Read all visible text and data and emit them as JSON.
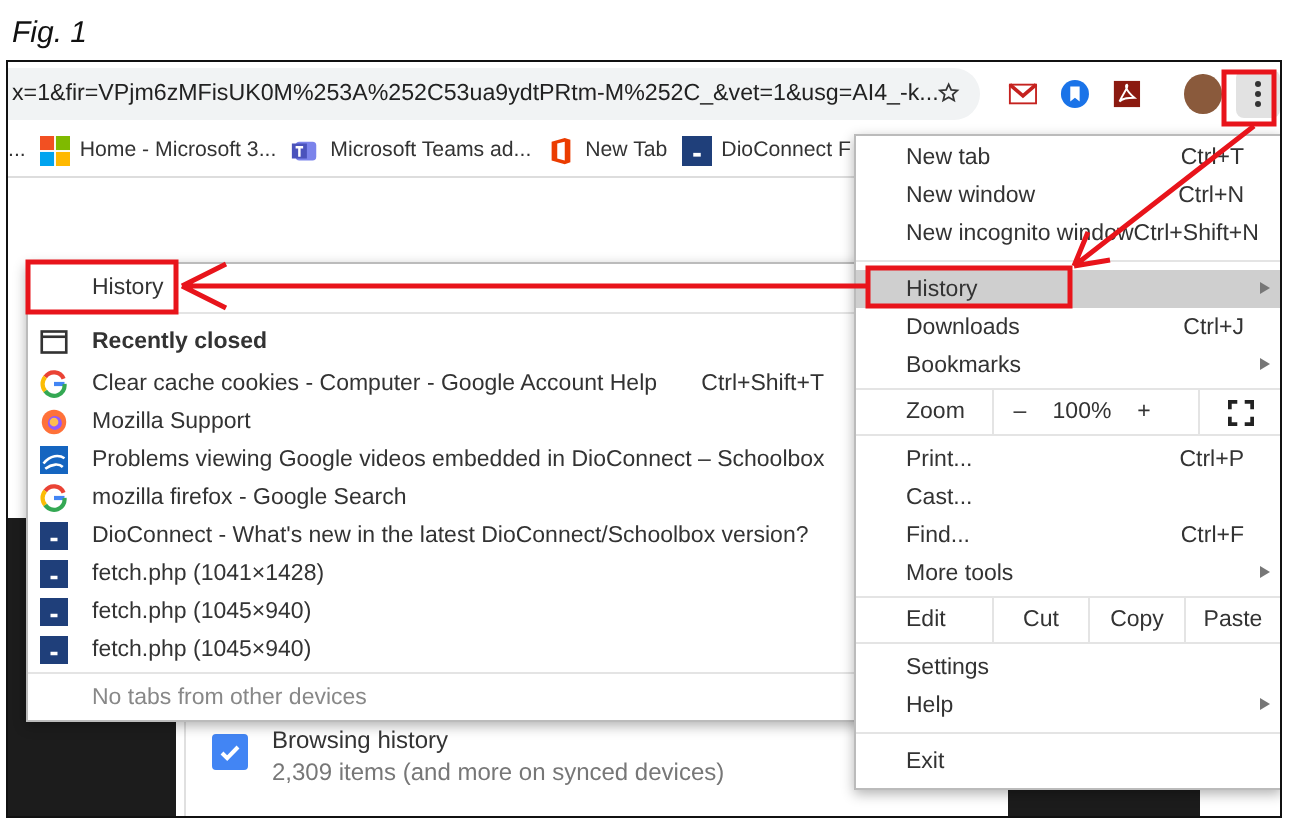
{
  "caption": "Fig. 1",
  "address_bar": {
    "url": "x=1&fir=VPjm6zMFisUK0M%253A%252C53ua9ydtPRtm-M%252C_&vet=1&usg=AI4_-k..."
  },
  "bookmarks": [
    {
      "label": "...",
      "kind": "none"
    },
    {
      "label": "Home - Microsoft 3...",
      "kind": "microsoft"
    },
    {
      "label": "Microsoft Teams ad...",
      "kind": "teams"
    },
    {
      "label": "New Tab",
      "kind": "office"
    },
    {
      "label": "DioConnect F",
      "kind": "dio"
    }
  ],
  "main_menu": {
    "items": [
      {
        "kind": "item",
        "label": "New tab",
        "shortcut": "Ctrl+T",
        "submenu": false,
        "selected": false
      },
      {
        "kind": "item",
        "label": "New window",
        "shortcut": "Ctrl+N",
        "submenu": false,
        "selected": false
      },
      {
        "kind": "item",
        "label": "New incognito window",
        "shortcut": "Ctrl+Shift+N",
        "submenu": false,
        "selected": false
      },
      {
        "kind": "separator"
      },
      {
        "kind": "item",
        "label": "History",
        "submenu": true,
        "selected": true
      },
      {
        "kind": "item",
        "label": "Downloads",
        "shortcut": "Ctrl+J",
        "submenu": false,
        "selected": false
      },
      {
        "kind": "item",
        "label": "Bookmarks",
        "submenu": true,
        "selected": false
      },
      {
        "kind": "zoom",
        "label": "Zoom",
        "minus": "–",
        "value": "100%",
        "plus": "+"
      },
      {
        "kind": "item",
        "label": "Print...",
        "shortcut": "Ctrl+P",
        "submenu": false,
        "selected": false
      },
      {
        "kind": "item",
        "label": "Cast...",
        "submenu": false,
        "selected": false
      },
      {
        "kind": "item",
        "label": "Find...",
        "shortcut": "Ctrl+F",
        "submenu": false,
        "selected": false
      },
      {
        "kind": "item",
        "label": "More tools",
        "submenu": true,
        "selected": false
      },
      {
        "kind": "edit",
        "label": "Edit",
        "buttons": [
          "Cut",
          "Copy",
          "Paste"
        ]
      },
      {
        "kind": "item",
        "label": "Settings",
        "submenu": false,
        "selected": false
      },
      {
        "kind": "item",
        "label": "Help",
        "submenu": true,
        "selected": false
      },
      {
        "kind": "separator"
      },
      {
        "kind": "item",
        "label": "Exit",
        "submenu": false,
        "selected": false
      }
    ]
  },
  "history_menu": {
    "title": "History",
    "section": "Recently closed",
    "items": [
      {
        "kind": "google",
        "label": "Clear cache  cookies - Computer - Google Account Help",
        "shortcut": "Ctrl+Shift+T"
      },
      {
        "kind": "firefox",
        "label": "Mozilla Support"
      },
      {
        "kind": "schoolbox",
        "label": "Problems viewing Google videos embedded in DioConnect – Schoolbox"
      },
      {
        "kind": "google",
        "label": "mozilla firefox - Google Search"
      },
      {
        "kind": "dio",
        "label": "DioConnect - What's new in the latest DioConnect/Schoolbox version?"
      },
      {
        "kind": "dio",
        "label": "fetch.php (1041×1428)"
      },
      {
        "kind": "dio",
        "label": "fetch.php (1045×940)"
      },
      {
        "kind": "dio",
        "label": "fetch.php (1045×940)"
      }
    ],
    "footer": "No tabs from other devices"
  },
  "page": {
    "option": {
      "label": "Browsing history",
      "detail": "2,309 items (and more on synced devices)",
      "checked": true
    }
  }
}
